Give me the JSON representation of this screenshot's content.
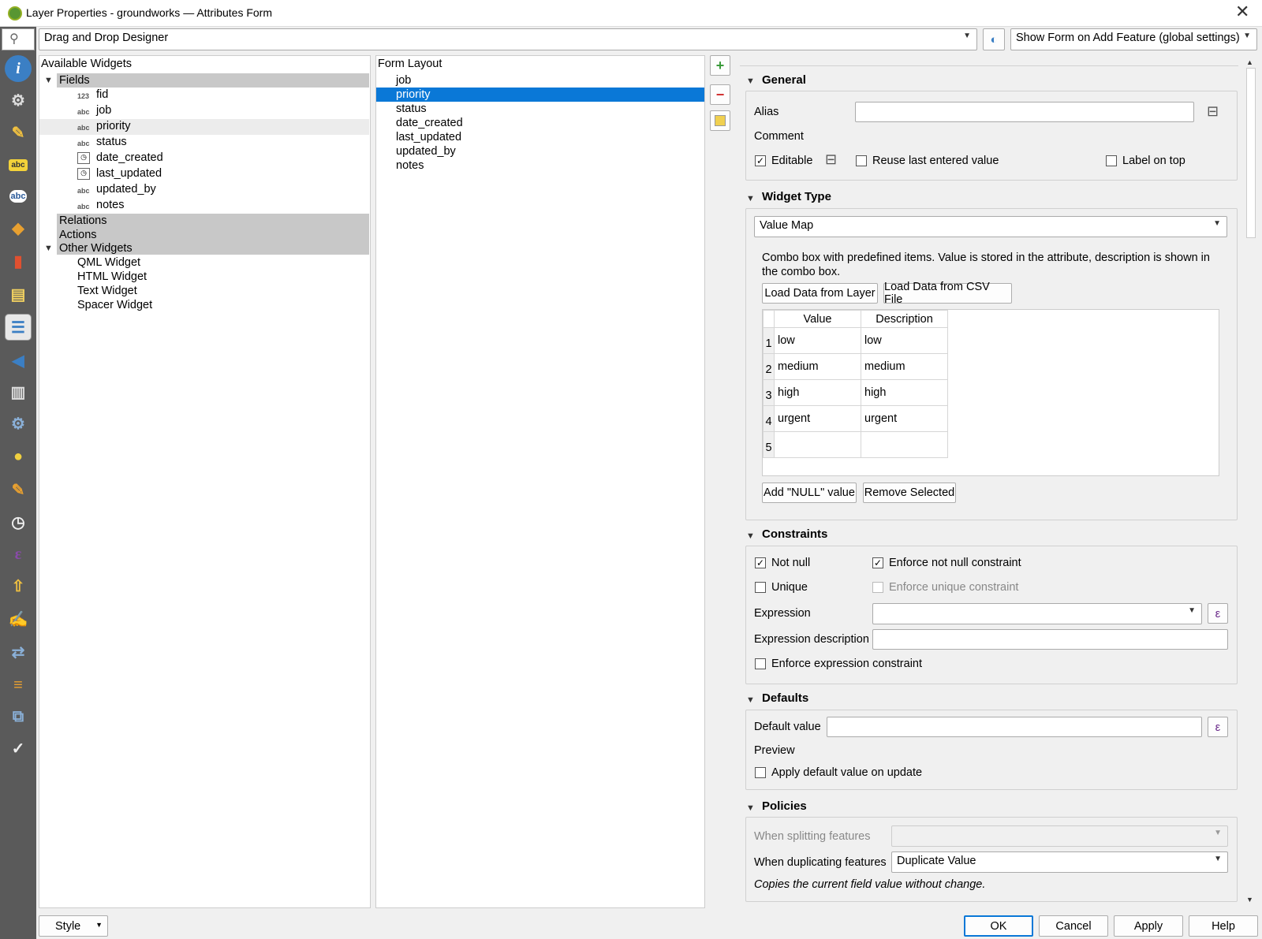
{
  "window": {
    "title": "Layer Properties - groundworks — Attributes Form",
    "close": "✕"
  },
  "topbar": {
    "mode": "Drag and Drop Designer",
    "form_on_add": "Show Form on Add Feature (global settings)"
  },
  "available_widgets": {
    "header": "Available Widgets",
    "fields_label": "Fields",
    "fields": [
      {
        "type": "123",
        "name": "fid"
      },
      {
        "type": "abc",
        "name": "job"
      },
      {
        "type": "abc",
        "name": "priority"
      },
      {
        "type": "abc",
        "name": "status"
      },
      {
        "type": "date",
        "name": "date_created"
      },
      {
        "type": "date",
        "name": "last_updated"
      },
      {
        "type": "abc",
        "name": "updated_by"
      },
      {
        "type": "abc",
        "name": "notes"
      }
    ],
    "relations_label": "Relations",
    "actions_label": "Actions",
    "other_label": "Other Widgets",
    "other": [
      "QML Widget",
      "HTML Widget",
      "Text Widget",
      "Spacer Widget"
    ]
  },
  "form_layout": {
    "header": "Form Layout",
    "items": [
      "job",
      "priority",
      "status",
      "date_created",
      "last_updated",
      "updated_by",
      "notes"
    ],
    "selected": "priority"
  },
  "general": {
    "title": "General",
    "alias_label": "Alias",
    "alias_value": "",
    "comment_label": "Comment",
    "editable_label": "Editable",
    "editable_checked": true,
    "reuse_label": "Reuse last entered value",
    "label_on_top": "Label on top"
  },
  "widget_type": {
    "title": "Widget Type",
    "selected": "Value Map",
    "description": "Combo box with predefined items. Value is stored in the attribute, description is shown in the combo box.",
    "load_layer": "Load Data from Layer",
    "load_csv": "Load Data from CSV File",
    "col_value": "Value",
    "col_desc": "Description",
    "rows": [
      {
        "n": "1",
        "value": "low",
        "desc": "low"
      },
      {
        "n": "2",
        "value": "medium",
        "desc": "medium"
      },
      {
        "n": "3",
        "value": "high",
        "desc": "high"
      },
      {
        "n": "4",
        "value": "urgent",
        "desc": "urgent"
      },
      {
        "n": "5",
        "value": "",
        "desc": ""
      }
    ],
    "add_null": "Add \"NULL\" value",
    "remove_selected": "Remove Selected"
  },
  "constraints": {
    "title": "Constraints",
    "not_null": "Not null",
    "enforce_not_null": "Enforce not null constraint",
    "unique": "Unique",
    "enforce_unique": "Enforce unique constraint",
    "expression": "Expression",
    "expression_desc": "Expression description",
    "enforce_expr": "Enforce expression constraint"
  },
  "defaults": {
    "title": "Defaults",
    "default_value": "Default value",
    "preview": "Preview",
    "apply_on_update": "Apply default value on update"
  },
  "policies": {
    "title": "Policies",
    "splitting_label": "When splitting features",
    "duplicating_label": "When duplicating features",
    "duplicating_value": "Duplicate Value",
    "note": "Copies the current field value without change."
  },
  "footer": {
    "style": "Style",
    "ok": "OK",
    "cancel": "Cancel",
    "apply": "Apply",
    "help": "Help"
  },
  "sidebar_icons": [
    "information-icon",
    "source-icon",
    "symbology-icon",
    "labels-icon",
    "masks-icon",
    "3d-view-icon",
    "diagrams-icon",
    "fields-icon",
    "attributes-form-icon",
    "joins-icon",
    "auxiliary-storage-icon",
    "actions-icon",
    "display-icon",
    "rendering-icon",
    "temporal-icon",
    "variables-icon",
    "elevation-icon",
    "metadata-icon",
    "dependencies-icon",
    "legend-icon",
    "qgis-server-icon",
    "digitizing-icon"
  ]
}
